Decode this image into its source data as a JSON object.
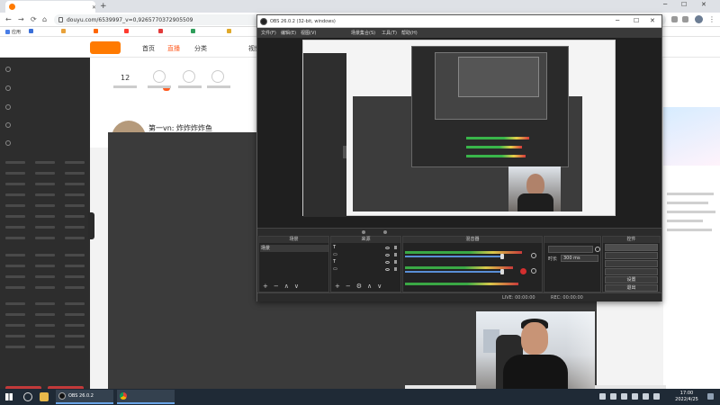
{
  "browser": {
    "tab_title": "",
    "url": "douyu.com/6539997_v=0,9265770372905509",
    "bookmarks": [
      "应用",
      "",
      "",
      "",
      "",
      "",
      ""
    ]
  },
  "douyu": {
    "topnav": [
      "首页",
      "直播",
      "分类",
      "",
      "视频"
    ],
    "stat_number": "12",
    "anchor_name": "第一vn: 炸炸炸炸鱼"
  },
  "obs": {
    "title": "OBS 26.0.2 (32-bit, windows)",
    "menu": [
      "文件(F)",
      "编辑(E)",
      "视图(V)",
      "",
      "场景集合(S)",
      "工具(T)",
      "帮助(H)"
    ],
    "no_source": "",
    "panels": {
      "scenes": {
        "title": "场景",
        "items": [
          "场景"
        ]
      },
      "sources": {
        "title": "来源",
        "items": [
          {
            "glyph": "T",
            "label": ""
          },
          {
            "glyph": "▭",
            "label": ""
          },
          {
            "glyph": "T",
            "label": ""
          },
          {
            "glyph": "▭",
            "label": ""
          }
        ]
      },
      "mixer": {
        "title": "混音器",
        "rows": [
          "",
          "",
          ""
        ]
      },
      "transitions": {
        "title": "",
        "type": "",
        "duration_label": "时长",
        "duration_value": "300 ms"
      },
      "controls": {
        "title": "控件",
        "buttons": [
          "",
          "",
          "",
          "",
          "设置",
          "退出"
        ]
      }
    },
    "footer": {
      "live": "LIVE: 00:00:00",
      "rec": "REC: 00:00:00",
      "cpu": ""
    }
  },
  "watermark": "",
  "taskbar": {
    "apps": [
      "OBS 26.0.2",
      ""
    ],
    "time": "17:00",
    "date": "2022/4/25"
  },
  "colors": {
    "douyu_orange": "#ff7a00",
    "douyu_accent": "#ff5d23",
    "obs_dark": "#2b2b2b",
    "watermark_pink": "#ff3aa8",
    "taskbar": "#1f2a36"
  }
}
